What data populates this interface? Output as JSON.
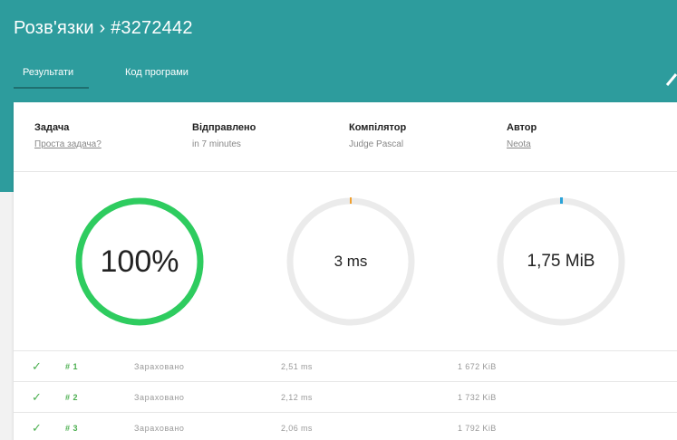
{
  "header": {
    "title": "Розв'язки › #3272442",
    "tabs": [
      {
        "label": "Результати",
        "active": true
      },
      {
        "label": "Код програми",
        "active": false
      }
    ]
  },
  "info": {
    "task_label": "Задача",
    "task_value": "Проста задача?",
    "sent_label": "Відправлено",
    "sent_value": "in 7 minutes",
    "compiler_label": "Компілятор",
    "compiler_value": "Judge Pascal",
    "author_label": "Автор",
    "author_value": "Neota"
  },
  "gauges": {
    "score": {
      "text": "100%",
      "fraction": 1.0,
      "color": "#2ecc5f"
    },
    "time": {
      "text": "3 ms",
      "marker_color": "#f0a030"
    },
    "memory": {
      "text": "1,75 MiB",
      "marker_color": "#2aa3d8"
    }
  },
  "results": [
    {
      "num": "# 1",
      "status": "Зараховано",
      "time": "2,51 ms",
      "memory": "1 672 KiB"
    },
    {
      "num": "# 2",
      "status": "Зараховано",
      "time": "2,12 ms",
      "memory": "1 732 KiB"
    },
    {
      "num": "# 3",
      "status": "Зараховано",
      "time": "2,06 ms",
      "memory": "1 792 KiB"
    }
  ],
  "colors": {
    "header_bg": "#2d9c9d",
    "accept_green": "#4caf50",
    "gauge_track": "#ebebeb"
  },
  "icons": {
    "check": "✓"
  }
}
